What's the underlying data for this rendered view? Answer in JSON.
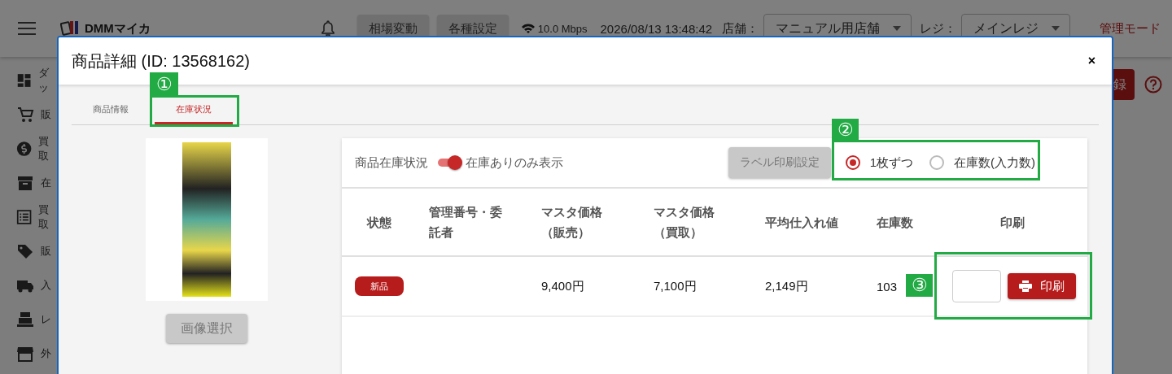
{
  "app_bar": {
    "logo": "DMMマイカ",
    "buttons": [
      "相場変動",
      "各種設定"
    ],
    "network_speed": "10.0 Mbps",
    "datetime": "2026/08/13 13:48:42",
    "store_label": "店舗：",
    "store_value": "マニュアル用店舗",
    "register_label": "レジ：",
    "register_value": "メインレジ",
    "mode": "管理モード"
  },
  "sidebar": {
    "items": [
      {
        "label": "ダッ"
      },
      {
        "label": "販"
      },
      {
        "label": "買取"
      },
      {
        "label": "在"
      },
      {
        "label": "買取"
      },
      {
        "label": "販"
      },
      {
        "label": "入"
      },
      {
        "label": "レ"
      },
      {
        "label": "外"
      }
    ]
  },
  "background_button": "録",
  "modal": {
    "title": "商品詳細 (ID: 13568162)",
    "close": "×",
    "tabs": [
      {
        "label": "商品情報",
        "selected": false
      },
      {
        "label": "在庫状況",
        "selected": true
      }
    ],
    "image_button": {
      "label": "画像選択",
      "disabled": true
    },
    "stock": {
      "title": "商品在庫状況",
      "toggle": {
        "label": "在庫ありのみ表示",
        "on": true
      },
      "label_settings_button": {
        "label": "ラベル印刷設定",
        "disabled": true
      },
      "print_mode": [
        {
          "label": "1枚ずつ",
          "selected": true
        },
        {
          "label": "在庫数(入力数)",
          "selected": false
        }
      ],
      "columns": [
        "状態",
        "管理番号・委託者",
        "マスタ価格（販売）",
        "マスタ価格（買取）",
        "平均仕入れ値",
        "在庫数",
        "印刷"
      ],
      "rows": [
        {
          "condition": "新品",
          "sell_price": "9,400円",
          "buy_price": "7,100円",
          "average_cost": "2,149円",
          "stock": "103",
          "print_button": "印刷"
        }
      ]
    }
  },
  "annotations": [
    {
      "label": "①"
    },
    {
      "label": "②"
    },
    {
      "label": "③"
    }
  ]
}
